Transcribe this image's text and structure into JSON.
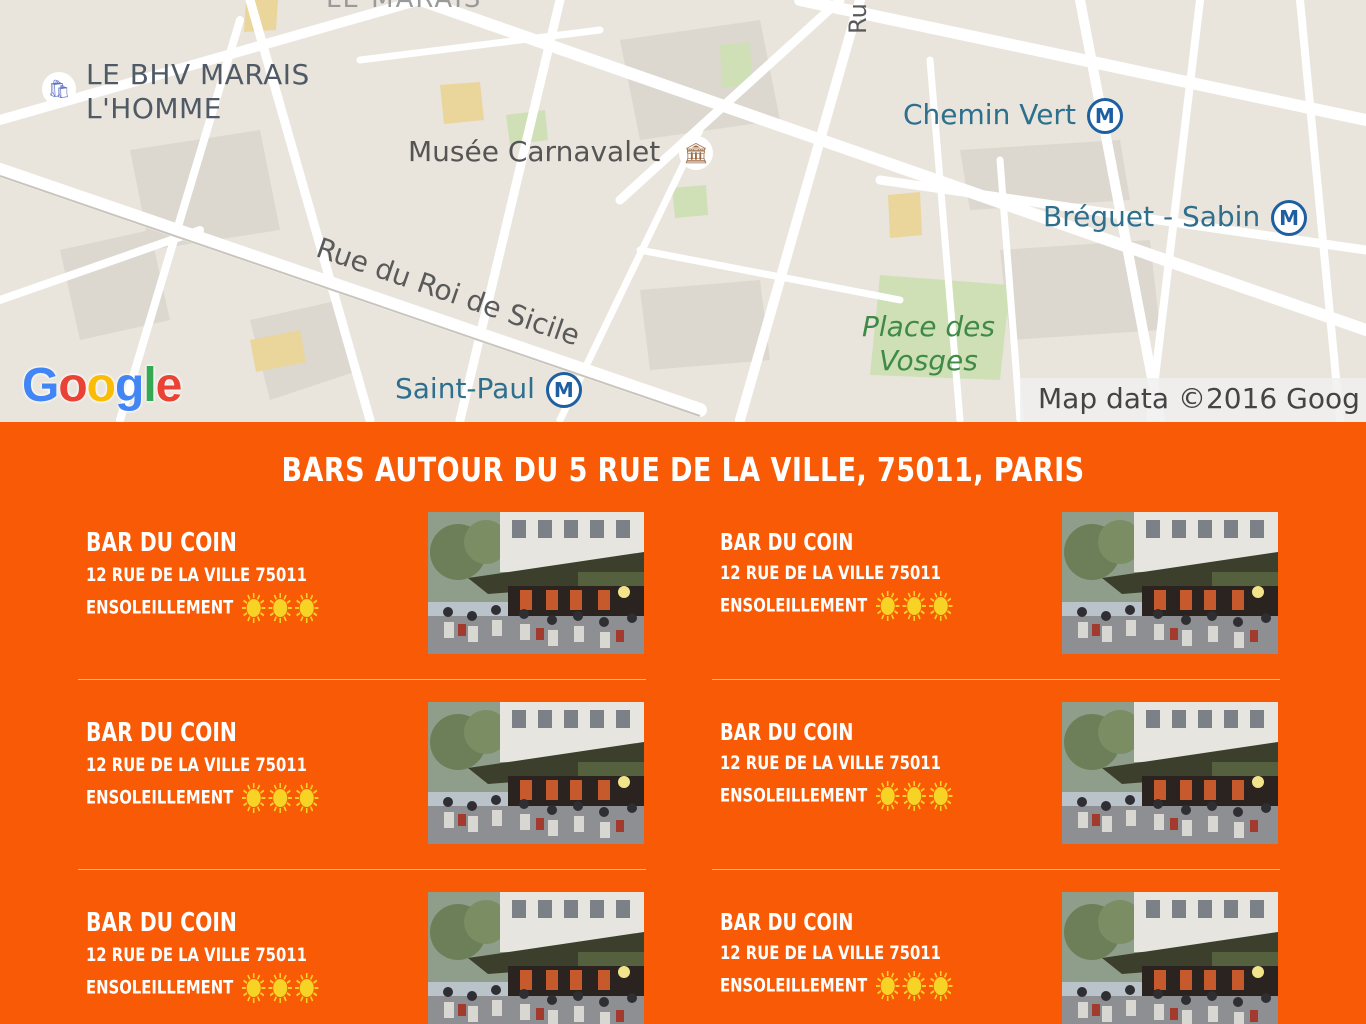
{
  "map": {
    "labels": {
      "district_top": "LE MARAIS",
      "bhv_line1": "LE BHV MARAIS",
      "bhv_line2": "L'HOMME",
      "musee": "Musée Carnavalet",
      "chemin_vert": "Chemin Vert",
      "breguet": "Bréguet - Sabin",
      "saint_paul": "Saint-Paul",
      "place_line1": "Place des",
      "place_line2": "Vosges",
      "rue_roi": "Rue du Roi de Sicile",
      "rue_partial": "Ru"
    },
    "metro_symbol": "M",
    "google_logo": [
      "G",
      "o",
      "o",
      "g",
      "l",
      "e"
    ],
    "attribution": "Map data ©2016 Goog"
  },
  "results": {
    "title": "BARS AUTOUR DU 5 RUE DE LA VILLE, 75011, PARIS",
    "bars": [
      {
        "name": "BAR DU COIN",
        "address": "12 RUE DE LA VILLE 75011",
        "sun_label": "ENSOLEILLEMENT",
        "sun_rating": 3
      },
      {
        "name": "BAR DU COIN",
        "address": "12 RUE DE LA VILLE 75011",
        "sun_label": "ENSOLEILLEMENT",
        "sun_rating": 3
      },
      {
        "name": "BAR DU COIN",
        "address": "12 RUE DE LA VILLE 75011",
        "sun_label": "ENSOLEILLEMENT",
        "sun_rating": 3
      },
      {
        "name": "BAR DU COIN",
        "address": "12 RUE DE LA VILLE 75011",
        "sun_label": "ENSOLEILLEMENT",
        "sun_rating": 3
      },
      {
        "name": "BAR DU COIN",
        "address": "12 RUE DE LA VILLE 75011",
        "sun_label": "ENSOLEILLEMENT",
        "sun_rating": 3
      },
      {
        "name": "BAR DU COIN",
        "address": "12 RUE DE LA VILLE 75011",
        "sun_label": "ENSOLEILLEMENT",
        "sun_rating": 3
      }
    ]
  },
  "colors": {
    "background": "#f85a05",
    "text": "#ffffff",
    "sun": "#f7d325"
  }
}
